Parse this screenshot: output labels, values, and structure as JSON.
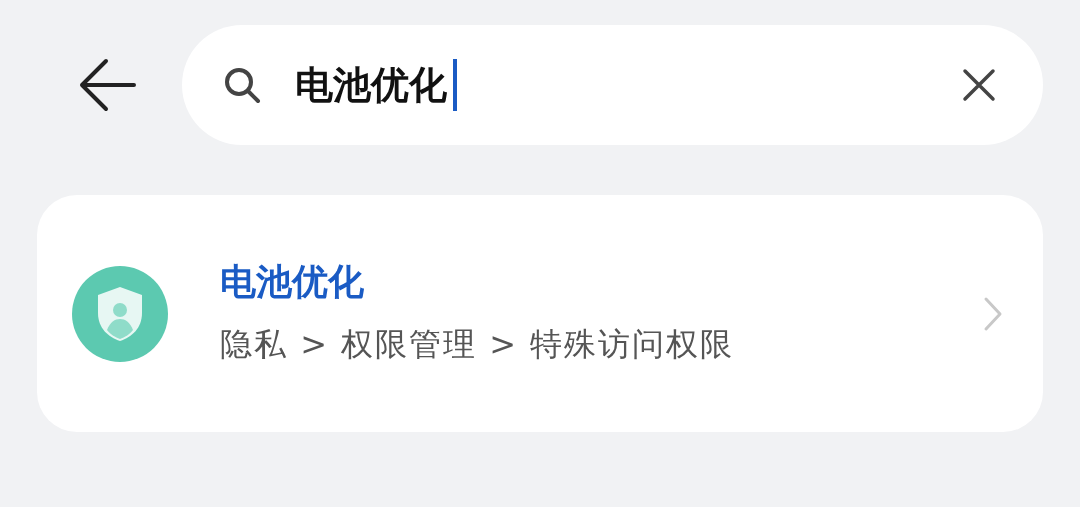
{
  "search": {
    "value": "电池优化"
  },
  "results": [
    {
      "title": "电池优化",
      "path": "隐私 > 权限管理 > 特殊访问权限"
    }
  ]
}
